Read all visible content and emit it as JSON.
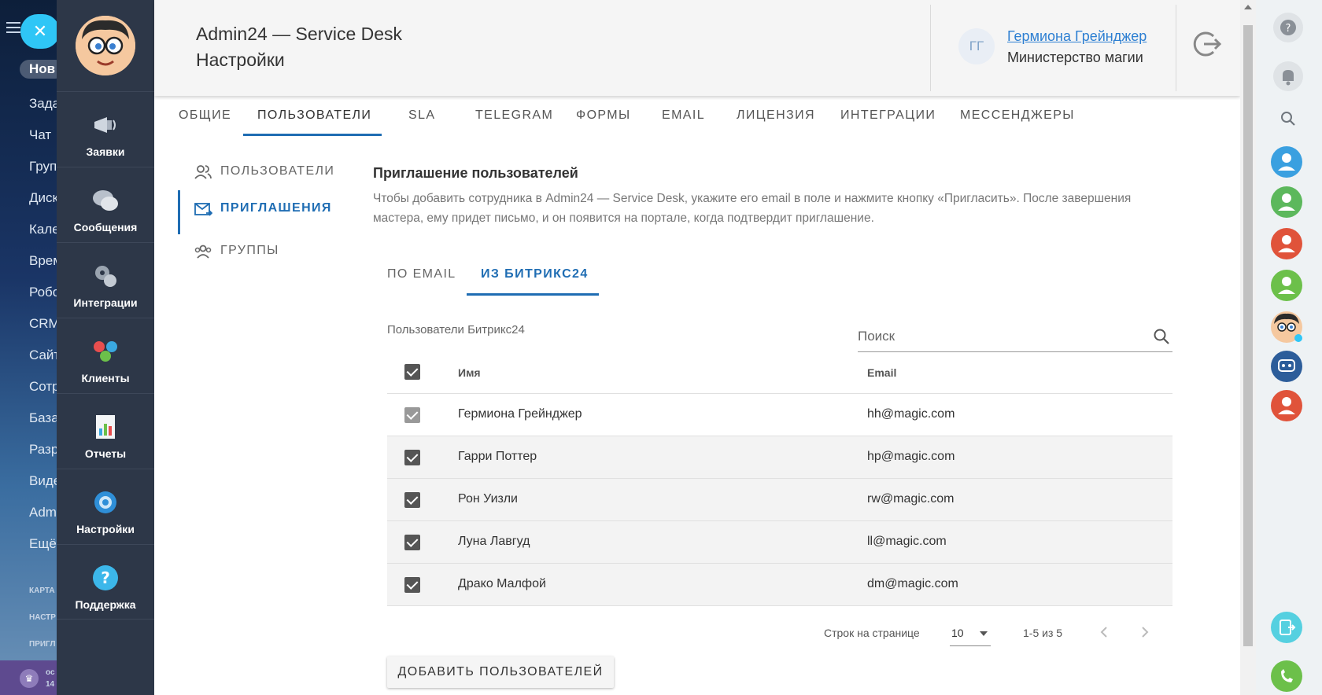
{
  "bitrix_menu": {
    "items": [
      "Нов",
      "Зада",
      "Чат",
      "Груп",
      "Диск",
      "Кале",
      "Врем",
      "Робо",
      "CRM",
      "Сайт",
      "Сотр",
      "База",
      "Разр",
      "Виде",
      "Adm",
      "Ещё"
    ],
    "sections": [
      "КАРТА",
      "НАСТР",
      "ПРИГЛ"
    ],
    "bottom": [
      "ос",
      "14"
    ]
  },
  "sd_nav": {
    "items": [
      {
        "label": "Заявки",
        "icon": "megaphone-icon"
      },
      {
        "label": "Сообщения",
        "icon": "chat-bubbles-icon"
      },
      {
        "label": "Интеграции",
        "icon": "puzzle-gears-icon"
      },
      {
        "label": "Клиенты",
        "icon": "people-balls-icon"
      },
      {
        "label": "Отчеты",
        "icon": "report-chart-icon"
      },
      {
        "label": "Настройки",
        "icon": "gear-icon"
      },
      {
        "label": "Поддержка",
        "icon": "question-icon"
      }
    ]
  },
  "header": {
    "title": "Admin24 — Service Desk",
    "subtitle": "Настройки",
    "user_initials": "ГГ",
    "user_name": "Гермиона Грейнджер",
    "user_org": "Министерство магии"
  },
  "tabs": [
    "ОБЩИЕ",
    "ПОЛЬЗОВАТЕЛИ",
    "SLA",
    "TELEGRAM",
    "ФОРМЫ",
    "EMAIL",
    "ЛИЦЕНЗИЯ",
    "ИНТЕГРАЦИИ",
    "МЕССЕНДЖЕРЫ"
  ],
  "subnav": [
    "ПОЛЬЗОВАТЕЛИ",
    "ПРИГЛАШЕНИЯ",
    "ГРУППЫ"
  ],
  "main": {
    "title": "Приглашение пользователей",
    "description": "Чтобы добавить сотрудника в Admin24 — Service Desk, укажите его email в поле и нажмите кнопку «Пригласить». После завершения мастера, ему придет письмо, и он появится на портале, когда подтвердит приглашение.",
    "subtabs": [
      "ПО EMAIL",
      "ИЗ БИТРИКС24"
    ],
    "table_caption": "Пользователи Битрикс24",
    "search_placeholder": "Поиск",
    "columns": {
      "name": "Имя",
      "email": "Email"
    },
    "rows": [
      {
        "name": "Гермиона Грейнджер",
        "email": "hh@magic.com"
      },
      {
        "name": "Гарри Поттер",
        "email": "hp@magic.com"
      },
      {
        "name": "Рон Уизли",
        "email": "rw@magic.com"
      },
      {
        "name": "Луна Лавгуд",
        "email": "ll@magic.com"
      },
      {
        "name": "Драко Малфой",
        "email": "dm@magic.com"
      }
    ],
    "pager": {
      "rows_per_page_label": "Строк на странице",
      "rows_per_page": "10",
      "range": "1-5 из 5"
    },
    "add_button": "ДОБАВИТЬ ПОЛЬЗОВАТЕЛЕЙ"
  },
  "colors": {
    "accent": "#1f6db3",
    "sidebar": "#2d3748",
    "link": "#2d7fd2"
  }
}
